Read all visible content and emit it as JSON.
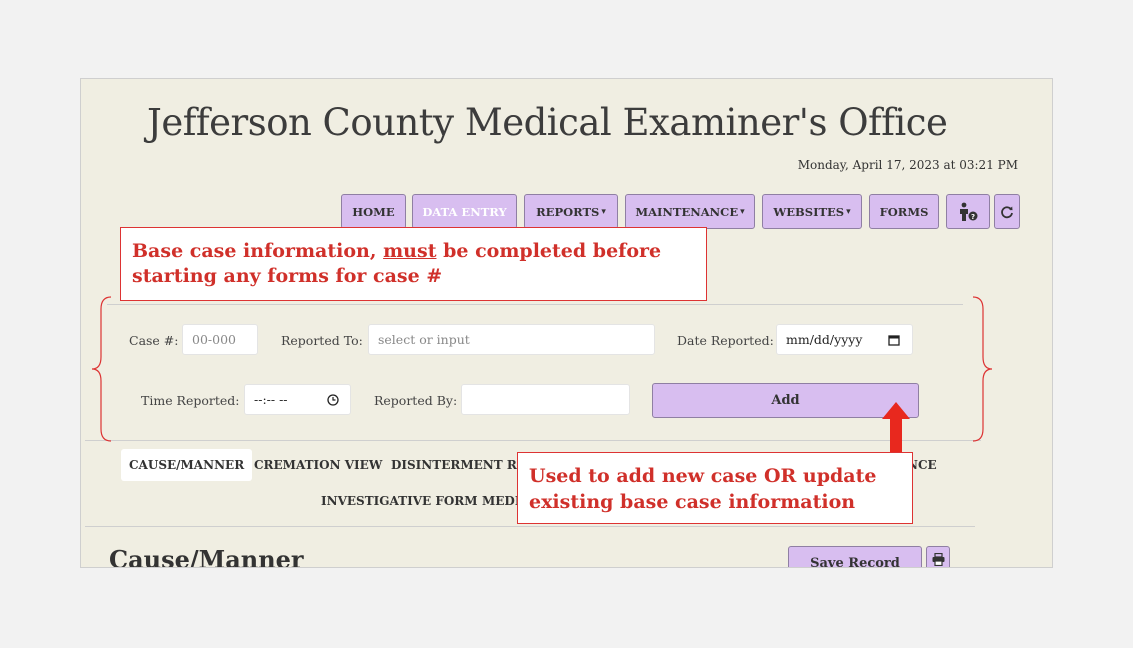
{
  "header": {
    "title": "Jefferson County Medical Examiner's Office",
    "datetime": "Monday, April 17, 2023 at 03:21 PM"
  },
  "nav": {
    "home": "HOME",
    "data_entry": "DATA ENTRY",
    "reports": "REPORTS",
    "maintenance": "MAINTENANCE",
    "websites": "WEBSITES",
    "forms": "FORMS"
  },
  "annotations": {
    "base_case_pre": "Base case information, ",
    "base_case_must": "must",
    "base_case_post": " be completed before starting any forms for case #",
    "add_note": "Used to add new case OR update existing base case information"
  },
  "form": {
    "case_label": "Case #:",
    "case_placeholder": "00-000",
    "reported_to_label": "Reported To:",
    "reported_to_placeholder": "select or input",
    "date_label": "Date Reported:",
    "date_placeholder": "mm/dd/yyyy",
    "time_label": "Time Reported:",
    "time_placeholder": "--:-- --",
    "reported_by_label": "Reported By:",
    "reported_by_value": "",
    "add_button": "Add"
  },
  "tabs": {
    "row1": [
      "CAUSE/MANNER",
      "CREMATION VIEW",
      "DISINTERMENT REL",
      "NCE"
    ],
    "row2": [
      "INVESTIGATIVE FORM",
      "MEDI"
    ]
  },
  "section": {
    "title": "Cause/Manner",
    "save_button": "Save Record"
  },
  "colors": {
    "button_bg": "#d8bef0",
    "annotation_red": "#d0302a",
    "panel_bg": "#f0eee2"
  },
  "icons": [
    "person-help-icon",
    "refresh-icon",
    "calendar-icon",
    "clock-icon",
    "printer-icon",
    "arrow-up-icon"
  ]
}
